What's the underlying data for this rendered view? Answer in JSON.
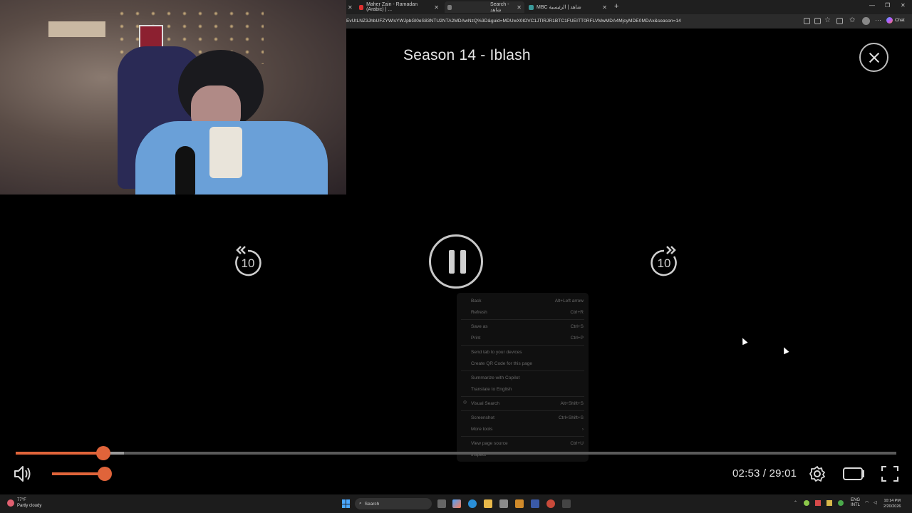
{
  "browser": {
    "tabs": [
      {
        "label": "Maher Zain - Ramadan (Arabic) | ...",
        "favicon_color": "#e03030"
      },
      {
        "label": "Search - شاهد",
        "favicon_color": "#7a7a7a"
      },
      {
        "label": "MBC شاهد | الرئيسية",
        "favicon_color": "#3a9a9a"
      }
    ],
    "url": "EvUtLNZ3JhbUFZYWlsYWJpbGl0eS83NTU2NTA2MDAwNzQ%3D&guid=MDUwX0lOVC1JTlRJR1BTC1FUEITT0RFLVMwMDA4MjcyMDE0MDAx&season=14",
    "chat_label": "Chat"
  },
  "player": {
    "title": "Season 14 - Iblash",
    "rewind_label": "10",
    "forward_label": "10",
    "time_display": "02:53 / 29:01",
    "progress_fraction": 0.0994,
    "buffered_fraction": 0.1229,
    "volume_fraction": 0.8,
    "accent_color": "#e0643a"
  },
  "context_menu": {
    "items": [
      {
        "label": "Back",
        "shortcut": "Alt+Left arrow"
      },
      {
        "label": "Refresh",
        "shortcut": "Ctrl+R"
      },
      {
        "label": "Save as",
        "shortcut": "Ctrl+S"
      },
      {
        "label": "Print",
        "shortcut": "Ctrl+P"
      },
      {
        "label": "Send tab to your devices",
        "shortcut": ""
      },
      {
        "label": "Create QR Code for this page",
        "shortcut": ""
      },
      {
        "label": "Summarize with Copilot",
        "shortcut": ""
      },
      {
        "label": "Translate to English",
        "shortcut": ""
      },
      {
        "label": "Visual Search",
        "shortcut": "Alt+Shift+S"
      },
      {
        "label": "Screenshot",
        "shortcut": "Ctrl+Shift+S"
      },
      {
        "label": "More tools",
        "shortcut": "›"
      },
      {
        "label": "View page source",
        "shortcut": "Ctrl+U"
      },
      {
        "label": "Inspect",
        "shortcut": ""
      }
    ]
  },
  "taskbar": {
    "weather_temp": "77°F",
    "weather_desc": "Partly cloudy",
    "search_label": "Search",
    "language": "ENG",
    "language_sub": "INTL",
    "time": "10:14 PM",
    "date": "2/20/2026"
  }
}
